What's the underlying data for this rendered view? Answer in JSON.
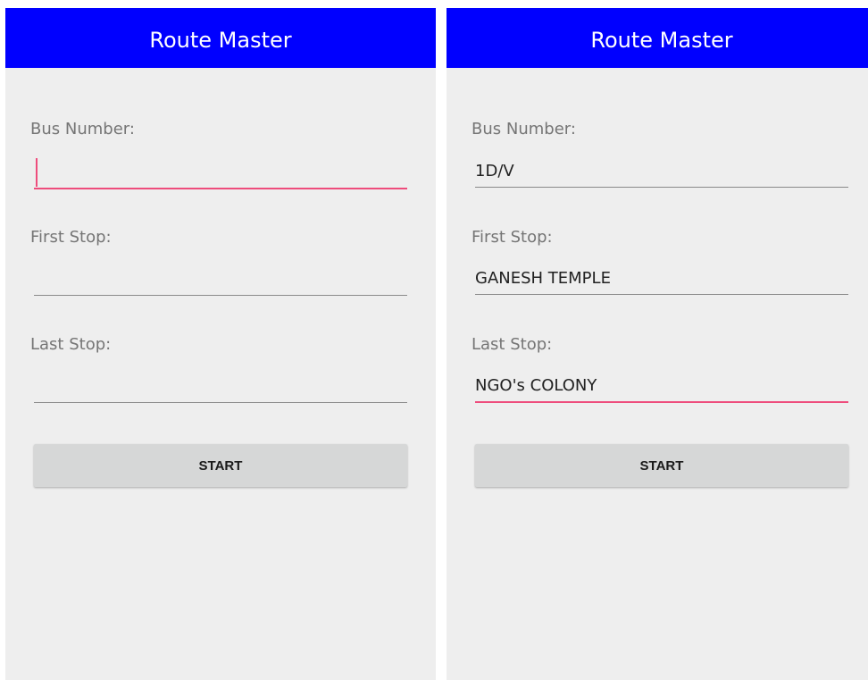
{
  "left_screen": {
    "app_title": "Route Master",
    "fields": {
      "bus_number": {
        "label": "Bus Number:",
        "value": ""
      },
      "first_stop": {
        "label": "First Stop:",
        "value": ""
      },
      "last_stop": {
        "label": "Last Stop:",
        "value": ""
      }
    },
    "start_label": "START"
  },
  "right_screen": {
    "app_title": "Route Master",
    "fields": {
      "bus_number": {
        "label": "Bus Number:",
        "value": "1D/V"
      },
      "first_stop": {
        "label": "First Stop:",
        "value": "GANESH TEMPLE"
      },
      "last_stop": {
        "label": "Last Stop:",
        "value": "NGO's COLONY"
      }
    },
    "start_label": "START"
  },
  "colors": {
    "app_bar": "#0000ff",
    "background": "#eeeeee",
    "accent_focus": "#ee4c7c",
    "button": "#d6d7d7"
  }
}
